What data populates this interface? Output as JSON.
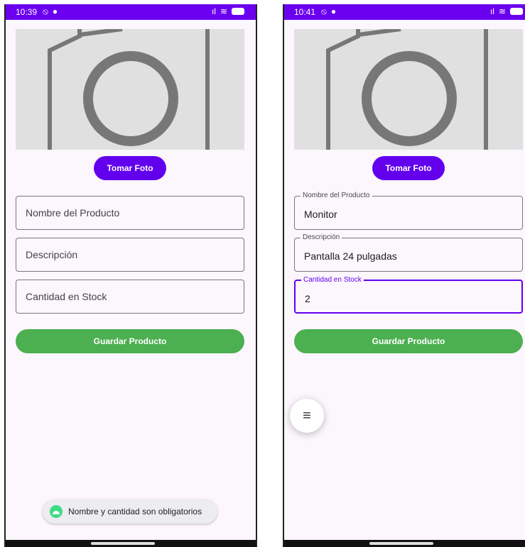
{
  "left_screen": {
    "status": {
      "time": "10:39"
    },
    "take_photo_label": "Tomar Foto",
    "fields": {
      "name_placeholder": "Nombre del Producto",
      "description_placeholder": "Descripción",
      "stock_placeholder": "Cantidad en Stock"
    },
    "save_label": "Guardar Producto",
    "toast": "Nombre y cantidad son obligatorios"
  },
  "right_screen": {
    "status": {
      "time": "10:41"
    },
    "take_photo_label": "Tomar Foto",
    "fields": {
      "name_label": "Nombre del Producto",
      "name_value": "Monitor",
      "description_label": "Descripción",
      "description_value": "Pantalla 24 pulgadas",
      "stock_label": "Cantidad en Stock",
      "stock_value": "2"
    },
    "save_label": "Guardar Producto",
    "fab_icon": "menu-icon"
  },
  "colors": {
    "status_bar": "#6b00f0",
    "primary": "#6200ee",
    "save_green": "#4caf50",
    "background": "#fcf6fd"
  }
}
